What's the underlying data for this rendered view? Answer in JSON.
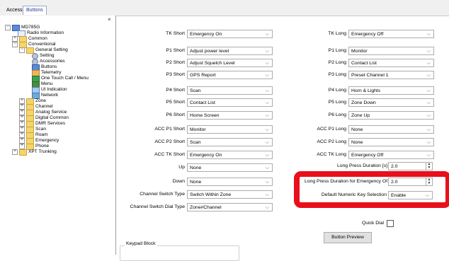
{
  "tabs": [
    "Accessories",
    "Buttons"
  ],
  "tree": {
    "close_glyph": "×",
    "nodes": [
      {
        "label": "MD785G",
        "icon": "device-icon",
        "level": 0,
        "exp": "-"
      },
      {
        "label": "Radio Information",
        "icon": "doc-icon",
        "level": 1,
        "exp": ""
      },
      {
        "label": "Common",
        "icon": "folder-icon",
        "level": 1,
        "exp": "+"
      },
      {
        "label": "Conventional",
        "icon": "folder-icon",
        "level": 1,
        "exp": "-"
      },
      {
        "label": "General Setting",
        "icon": "folder-icon",
        "level": 2,
        "exp": "-"
      },
      {
        "label": "Setting",
        "icon": "wrench-icon",
        "level": 3,
        "exp": ""
      },
      {
        "label": "Accessories",
        "icon": "gear-icon",
        "level": 3,
        "exp": ""
      },
      {
        "label": "Buttons",
        "icon": "radio-icon",
        "level": 3,
        "exp": ""
      },
      {
        "label": "Telemetry",
        "icon": "telemetry-icon",
        "level": 3,
        "exp": ""
      },
      {
        "label": "One Touch Call / Menu",
        "icon": "one-touch-icon",
        "level": 3,
        "exp": ""
      },
      {
        "label": "Menu",
        "icon": "menu-icon",
        "level": 3,
        "exp": ""
      },
      {
        "label": "UI Indication",
        "icon": "ui-indication-icon",
        "level": 3,
        "exp": ""
      },
      {
        "label": "Network",
        "icon": "network-icon",
        "level": 3,
        "exp": ""
      },
      {
        "label": "Zone",
        "icon": "folder-icon",
        "level": 2,
        "exp": "+"
      },
      {
        "label": "Channel",
        "icon": "folder-icon",
        "level": 2,
        "exp": "+"
      },
      {
        "label": "Analog Service",
        "icon": "folder-icon",
        "level": 2,
        "exp": "+"
      },
      {
        "label": "Digital Common",
        "icon": "folder-icon",
        "level": 2,
        "exp": "+"
      },
      {
        "label": "DMR Services",
        "icon": "folder-icon",
        "level": 2,
        "exp": "+"
      },
      {
        "label": "Scan",
        "icon": "folder-icon",
        "level": 2,
        "exp": "+"
      },
      {
        "label": "Roam",
        "icon": "folder-icon",
        "level": 2,
        "exp": "+"
      },
      {
        "label": "Emergency",
        "icon": "folder-icon",
        "level": 2,
        "exp": "+"
      },
      {
        "label": "Phone",
        "icon": "folder-icon",
        "level": 2,
        "exp": "+"
      },
      {
        "label": "XPT Trunking",
        "icon": "folder-icon",
        "level": 1,
        "exp": "+"
      }
    ]
  },
  "left_rows": [
    {
      "label": "TK Short",
      "value": "Emergency On"
    },
    {
      "label": "P1 Short",
      "value": "Adjust power level"
    },
    {
      "label": "P2 Short",
      "value": "Adjust Squelch Level"
    },
    {
      "label": "P3 Short",
      "value": "GPS Report"
    },
    {
      "label": "P4 Short",
      "value": "Scan"
    },
    {
      "label": "P5 Short",
      "value": "Contact List"
    },
    {
      "label": "P6 Short",
      "value": "Home Screen"
    },
    {
      "label": "ACC P1 Short",
      "value": "Monitor"
    },
    {
      "label": "ACC P2 Short",
      "value": "Scan"
    },
    {
      "label": "ACC TK Short",
      "value": "Emergency On"
    },
    {
      "label": "Up",
      "value": "None"
    },
    {
      "label": "Down",
      "value": "None"
    },
    {
      "label": "Channel Switch Type",
      "value": "Switch Within Zone"
    },
    {
      "label": "Channel Switch Dial Type",
      "value": "Zone#Channel"
    }
  ],
  "right_rows": [
    {
      "label": "TK Long",
      "value": "Emergency Off"
    },
    {
      "label": "P1 Long",
      "value": "Monitor"
    },
    {
      "label": "P2 Long",
      "value": "Contact List"
    },
    {
      "label": "P3 Long",
      "value": "Preset Channel 1"
    },
    {
      "label": "P4 Long",
      "value": "Horn & Lights"
    },
    {
      "label": "P5 Long",
      "value": "Zone Down"
    },
    {
      "label": "P6 Long",
      "value": "Zone Up"
    },
    {
      "label": "ACC P1 Long",
      "value": "None"
    },
    {
      "label": "ACC P2 Long",
      "value": "None"
    },
    {
      "label": "ACC TK Long",
      "value": "Emergency Off"
    }
  ],
  "long_press": {
    "label": "Long Press Duration [s]",
    "value": "2.0"
  },
  "emergency_off": {
    "label": "Long Press Duration for Emergency Off [s]",
    "value": "2.0"
  },
  "numeric_key": {
    "label": "Default Numeric Key Selection",
    "value": "Enable"
  },
  "quick_dial_label": "Quick Dial",
  "button_preview_label": "Button Preview",
  "keypad_block_label": "Keypad Block",
  "highlight_color": "#e8101a"
}
